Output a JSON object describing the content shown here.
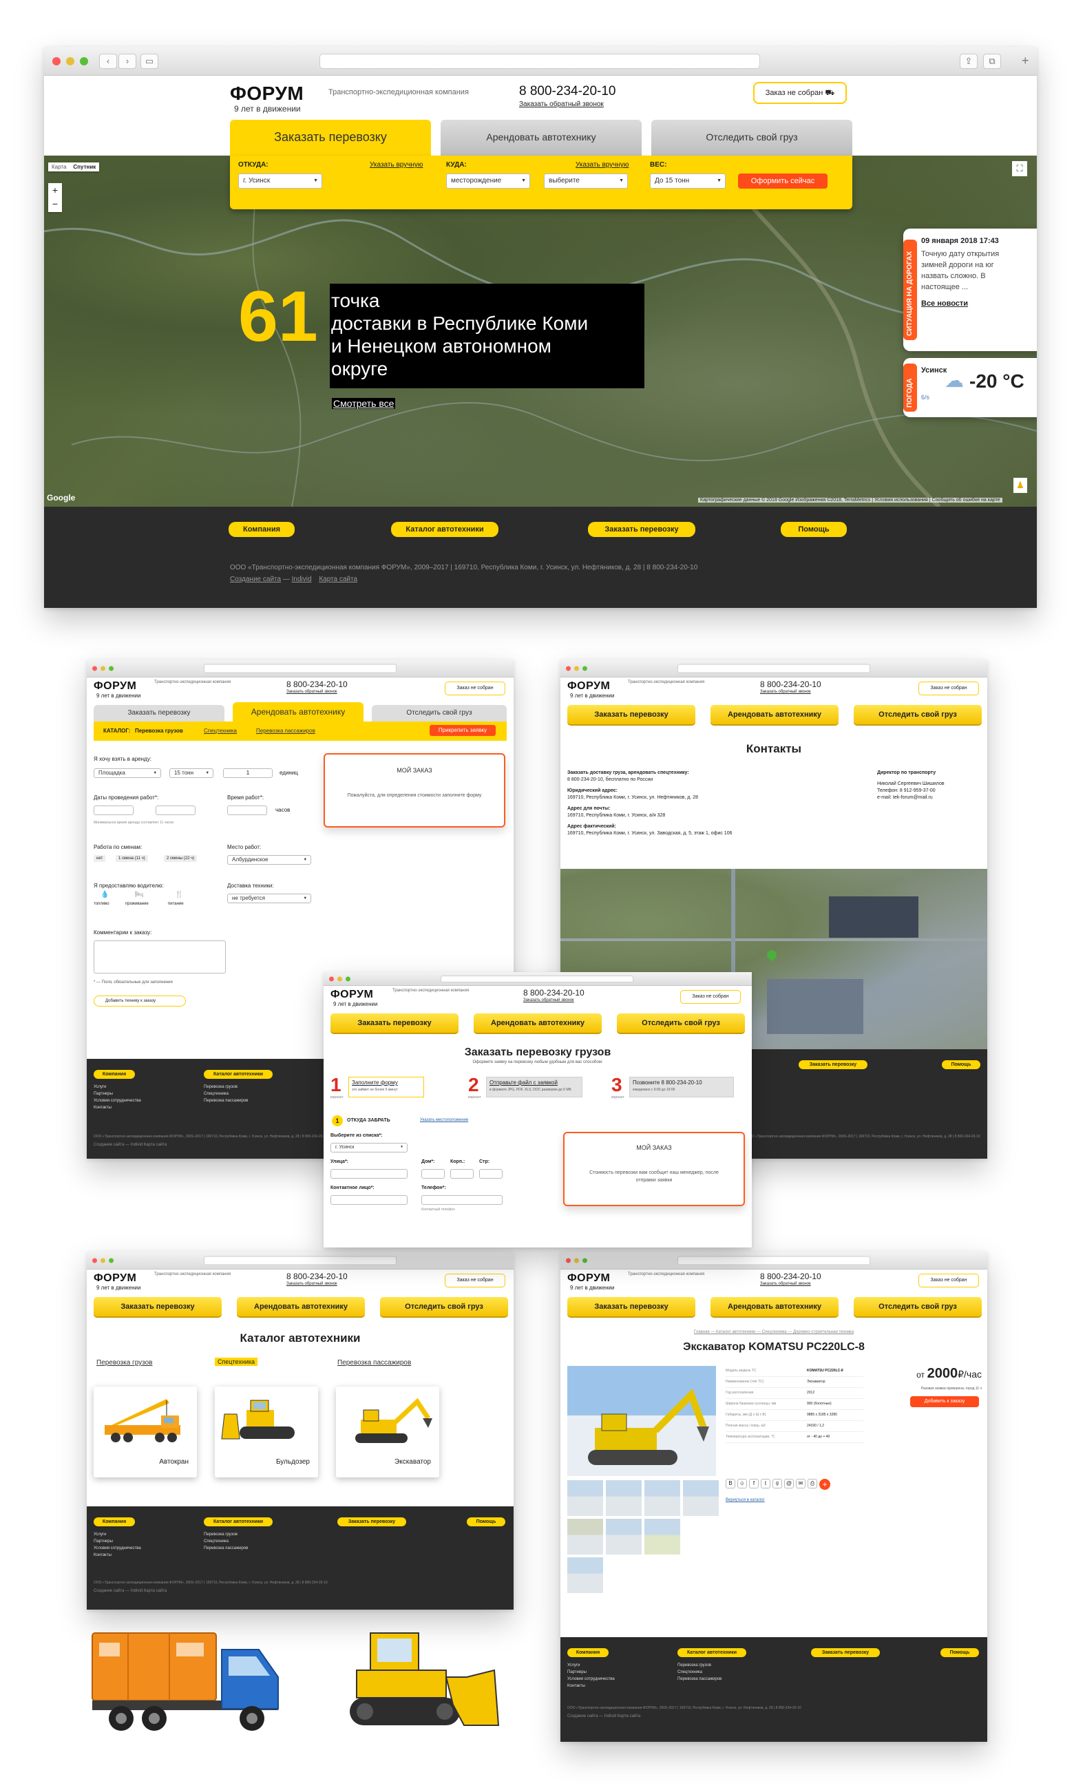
{
  "brand": {
    "logo": "ФОРУМ",
    "tagline": "9 лет в движении",
    "descr": "Транспортно-экспедиционная компания",
    "phone": "8 800-234-20-10",
    "callback": "Заказать обратный звонок",
    "order_btn": "Заказ не собран"
  },
  "tabs": [
    "Заказать перевозку",
    "Арендовать автотехнику",
    "Отследить свой груз"
  ],
  "form": {
    "from_label": "ОТКУДА:",
    "to_label": "КУДА:",
    "weight_label": "ВЕС:",
    "manual_link": "Указать вручную",
    "from_value": "г. Усинск",
    "to_value": "месторождение",
    "to_value2": "выберите",
    "weight_value": "До 15 тонн",
    "submit": "Оформить сейчас"
  },
  "map": {
    "type_map": "Карта",
    "type_sat": "Спутник",
    "big_number": "61",
    "headline": [
      "точка",
      "доставки в Республике Коми",
      "и Ненецком автономном",
      "округе"
    ],
    "see_all": "Смотреть все",
    "google": "Google",
    "attribution": "Картографические данные © 2018 Google Изображения ©2018, TerraMetrics | Условия использования | Сообщить об ошибке на карте"
  },
  "side_news": {
    "tab": "СИТУАЦИЯ НА ДОРОГАХ",
    "date": "09 января 2018 17:43",
    "text": "Точную дату открытия зимней дороги на юг назвать сложно. В настоящее ...",
    "link": "Все новости"
  },
  "weather": {
    "tab": "ПОГОДА",
    "city": "Усинск",
    "temp": "-20 °C",
    "wind": "6/s"
  },
  "footer": {
    "buttons": [
      "Компания",
      "Каталог автотехники",
      "Заказать перевозку",
      "Помощь"
    ],
    "copyright": "ООО «Транспортно-экспедиционная компания ФОРУМ», 2009–2017 | 169710, Республика Коми, г. Усинск, ул. Нефтяников, д. 28 | 8 800-234-20-10",
    "credits": [
      "Создание сайта",
      "—",
      "Individ",
      "Карта сайта"
    ],
    "links1": [
      "Услуги",
      "Партнеры",
      "Условия сотрудничества",
      "Контакты"
    ],
    "links2": [
      "Перевозка грузов",
      "Спецтехника",
      "Перевозка пассажиров"
    ]
  },
  "rent": {
    "catalog_label": "КАТАЛОГ:",
    "cats": [
      "Перевозка грузов",
      "Спецтехника",
      "Перевозка пассажиров"
    ],
    "attach_btn": "Прикрепить заявку",
    "want_label": "Я хочу взять в аренду:",
    "want_values": [
      "Площадка",
      "15 тонн",
      "1",
      "единиц"
    ],
    "dates_label": "Даты проведения работ*:",
    "time_label": "Время работ*:",
    "hours": "часов",
    "min_note": "Минимальное время аренды составляет 11 часов",
    "shifts_label": "Работа по сменам:",
    "shifts": [
      "нет",
      "1 смена (11 ч)",
      "2 смены (22 ч)"
    ],
    "place_label": "Место работ:",
    "place_value": "Албурдинское",
    "provide_label": "Я предоставляю водителю:",
    "provide": [
      "топливо",
      "проживание",
      "питание"
    ],
    "delivery_label": "Доставка техники:",
    "delivery_value": "не требуется",
    "comment_label": "Комментарии к заказу:",
    "required_note": "* — Поля, обязательные для заполнения",
    "add_btn": "Добавить технику к заказу",
    "my_order": "МОЙ ЗАКАЗ",
    "my_order_text": "Пожалуйста, для определения стоимости заполните форму"
  },
  "contacts": {
    "title": "Контакты",
    "order_label": "Заказать доставку груза, арендовать спецтехнику:",
    "order_value": "8 800-234-20-10, бесплатно по России",
    "legal_label": "Юридический адрес:",
    "legal_value": "169710, Республика Коми, г. Усинск, ул. Нефтяников, д. 28",
    "mail_label": "Адрес для почты:",
    "mail_value": "169710, Республика Коми, г. Усинск, а/я 328",
    "fact_label": "Адрес фактический:",
    "fact_value": "169710, Республика Коми, г. Усинск, ул. Заводская, д. 5, этаж 1, офис 106",
    "director_label": "Директор по транспорту",
    "director_name": "Николай Сергеевич Шишилов",
    "director_phone": "Телефон: 8 912-959-37-00",
    "director_email": "e-mail: tek-forum@mail.ru"
  },
  "order_page": {
    "title": "Заказать перевозку грузов",
    "subtitle": "Оформите заявку на перевозку любым удобным для вас способом:",
    "steps": [
      {
        "num": "1",
        "word": "вариант",
        "title": "Заполните форму",
        "text": "это займет не более 5 минут"
      },
      {
        "num": "2",
        "word": "вариант",
        "title": "Отправьте файл с заявкой",
        "text": "в формате JPG, PDF, XLS, DOC размером до 6 МБ"
      },
      {
        "num": "3",
        "word": "вариант",
        "title": "Позвоните 8 800-234-20-10",
        "text": "ежедневно с 9:00 до 19:00"
      }
    ],
    "where_from": "ОТКУДА ЗАБРАТЬ",
    "manual": "Указать местоположение",
    "choose_label": "Выберите из списка*:",
    "choose_value": "г. Усинск",
    "street": "Улица*:",
    "house": "Дом*:",
    "korp": "Корп.:",
    "build": "Стр:",
    "contact": "Контактное лицо*:",
    "phone": "Телефон*:",
    "phone_note": "Контактный телефон",
    "my_order": "МОЙ ЗАКАЗ",
    "my_order_text": "Стоимость перевозки вам сообщит наш менеджер, после отправки заявки"
  },
  "catalog": {
    "title": "Каталог автотехники",
    "cats": [
      "Перевозка грузов",
      "Спецтехника",
      "Перевозка пассажиров"
    ],
    "items": [
      "Автокран",
      "Бульдозер",
      "Экскаватор"
    ]
  },
  "product": {
    "breadcrumbs": "Главная — Каталог автотехники — Спецтехника — Дорожно-строительная техника",
    "title": "Экскаватор KOMATSU PC220LC-8",
    "price_from": "от",
    "price": "2000",
    "unit": "₽/час",
    "price_note": "Разовая заявка проверена, город 11 ч",
    "add_btn": "Добавить к заказу",
    "back": "Вернуться в каталог",
    "specs": [
      [
        "Модель модель ТС",
        "KOMATSU PC220LC-8"
      ],
      [
        "Наименование (тип ТС)",
        "Экскаватор"
      ],
      [
        "Год изготовления",
        "2012"
      ],
      [
        "Ширина башмака гусеницы, мм",
        "900 (болотные)"
      ],
      [
        "Габариты, мм (Д х Ш х В)",
        "9885 x 3185 x 3280"
      ],
      [
        "Полная масса / ковш, м3",
        "24330 / 1,2"
      ],
      [
        "Температура эксплуатации, °С",
        "от - 40 до + 40"
      ]
    ]
  }
}
